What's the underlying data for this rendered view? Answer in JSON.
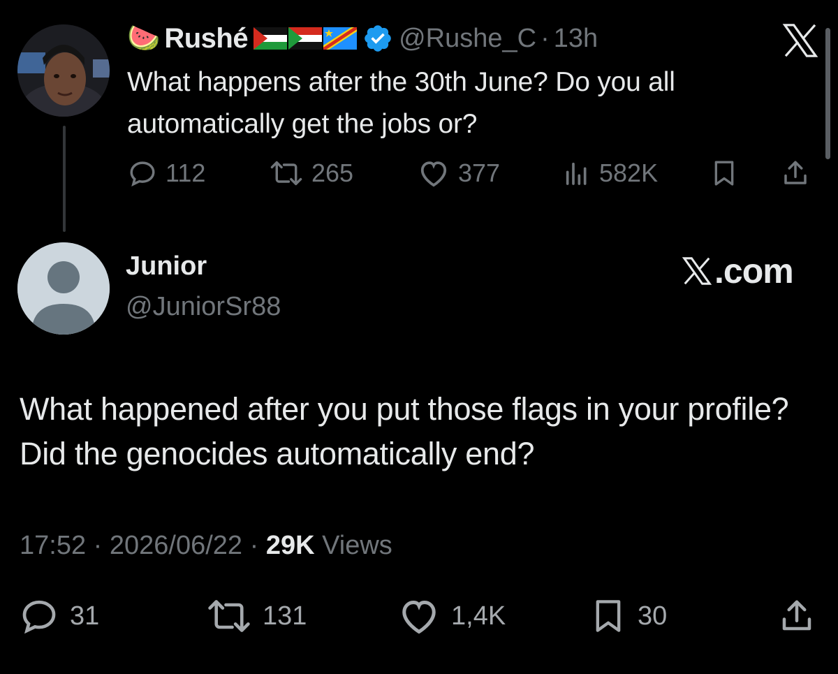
{
  "parent_tweet": {
    "emoji": "🍉",
    "display_name": "Rushé",
    "handle": "@Rushe_C",
    "separator": "·",
    "time_ago": "13h",
    "text": "What happens after the 30th June? Do you all automatically get the jobs or?",
    "metrics": {
      "replies": "112",
      "reposts": "265",
      "likes": "377",
      "views": "582K"
    },
    "flags": [
      "palestine-flag",
      "sudan-flag",
      "dr-congo-flag"
    ],
    "verified_icon": "verified-badge-icon",
    "accent_color": "#1d9bf0"
  },
  "reply_tweet": {
    "display_name": "Junior",
    "handle": "@JuniorSr88",
    "watermark": ".com",
    "text": "What happened after you put those flags in your profile? Did the genocides automatically end?",
    "time": "17:52",
    "date": "2026/06/22",
    "dot": "·",
    "views_count": "29K",
    "views_label": "Views",
    "metrics": {
      "replies": "31",
      "reposts": "131",
      "likes": "1,4K",
      "bookmarks": "30"
    }
  },
  "colors": {
    "background": "#000000",
    "primary_text": "#e7e9ea",
    "secondary_text": "#71767b"
  }
}
